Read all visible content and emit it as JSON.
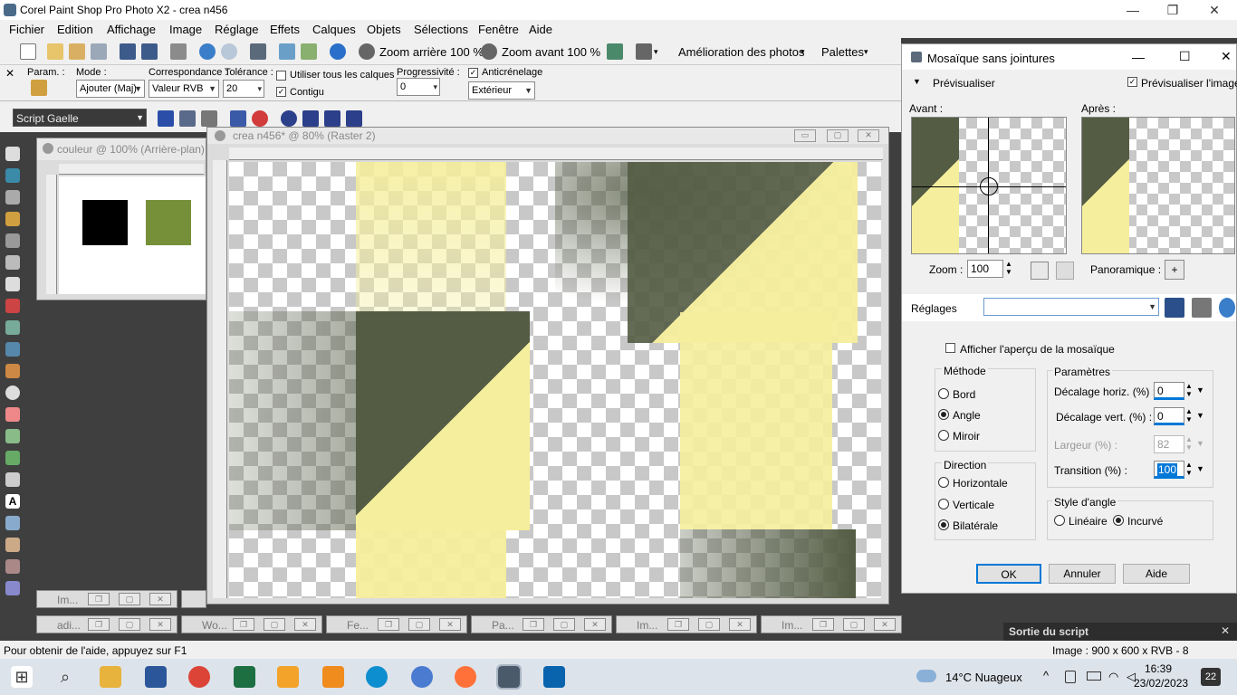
{
  "app": {
    "title": "Corel Paint Shop Pro Photo X2 - crea n456"
  },
  "menu": [
    "Fichier",
    "Edition",
    "Affichage",
    "Image",
    "Réglage",
    "Effets",
    "Calques",
    "Objets",
    "Sélections",
    "Fenêtre",
    "Aide"
  ],
  "toolbar": {
    "zoom_out": "Zoom arrière 100 %",
    "zoom_in": "Zoom avant 100 %",
    "photo_enhance": "Amélioration des photos",
    "palettes": "Palettes"
  },
  "options": {
    "param_label": "Param. :",
    "mode_label": "Mode :",
    "mode_value": "Ajouter (Maj)",
    "match_label": "Correspondance :",
    "match_value": "Valeur RVB",
    "tolerance_label": "Tolérance :",
    "tolerance_value": "20",
    "use_all_layers": "Utiliser tous les calques",
    "contiguous": "Contigu",
    "progressivity_label": "Progressivité :",
    "progressivity_value": "0",
    "antialias": "Anticrénelage",
    "antialias_mode": "Extérieur"
  },
  "script": {
    "name": "Script Gaelle"
  },
  "windows": {
    "couleur_title": "couleur @ 100% (Arrière-plan)",
    "crea_title": "crea n456* @ 80% (Raster 2)",
    "swatch1_color": "#000000",
    "swatch2_color": "#76903a"
  },
  "minimized": [
    "Im...",
    "adi...",
    "Wo...",
    "Fe...",
    "Pa...",
    "Im...",
    "Im..."
  ],
  "dialog": {
    "title": "Mosaïque sans jointures",
    "preview_section": "Prévisualiser",
    "preview_image": "Prévisualiser l'image",
    "before": "Avant :",
    "after": "Après :",
    "zoom_label": "Zoom :",
    "zoom_value": "100",
    "pan_label": "Panoramique :",
    "settings_label": "Réglages",
    "show_tile_preview": "Afficher l'aperçu de la mosaïque",
    "method_label": "Méthode",
    "method_options": [
      "Bord",
      "Angle",
      "Miroir"
    ],
    "direction_label": "Direction",
    "direction_options": [
      "Horizontale",
      "Verticale",
      "Bilatérale"
    ],
    "params_label": "Paramètres",
    "h_offset_label": "Décalage horiz. (%) :",
    "h_offset_value": "0",
    "v_offset_label": "Décalage vert. (%) :",
    "v_offset_value": "0",
    "width_label": "Largeur (%) :",
    "width_value": "82",
    "transition_label": "Transition (%) :",
    "transition_value": "100",
    "corner_style_label": "Style d'angle",
    "corner_options": [
      "Linéaire",
      "Incurvé"
    ],
    "ok": "OK",
    "cancel": "Annuler",
    "help": "Aide"
  },
  "script_output": "Sortie du script",
  "status": {
    "help": "Pour obtenir de l'aide, appuyez sur F1",
    "image_info": "Image : 900 x 600 x RVB - 8 bits/canal"
  },
  "taskbar": {
    "weather": "14°C Nuageux",
    "time": "16:39",
    "date": "23/02/2023",
    "notif_count": "22"
  },
  "colors": {
    "olive_dark": "#545c44",
    "pale_yellow": "#f5ee9c",
    "accent_blue": "#0078d7"
  }
}
